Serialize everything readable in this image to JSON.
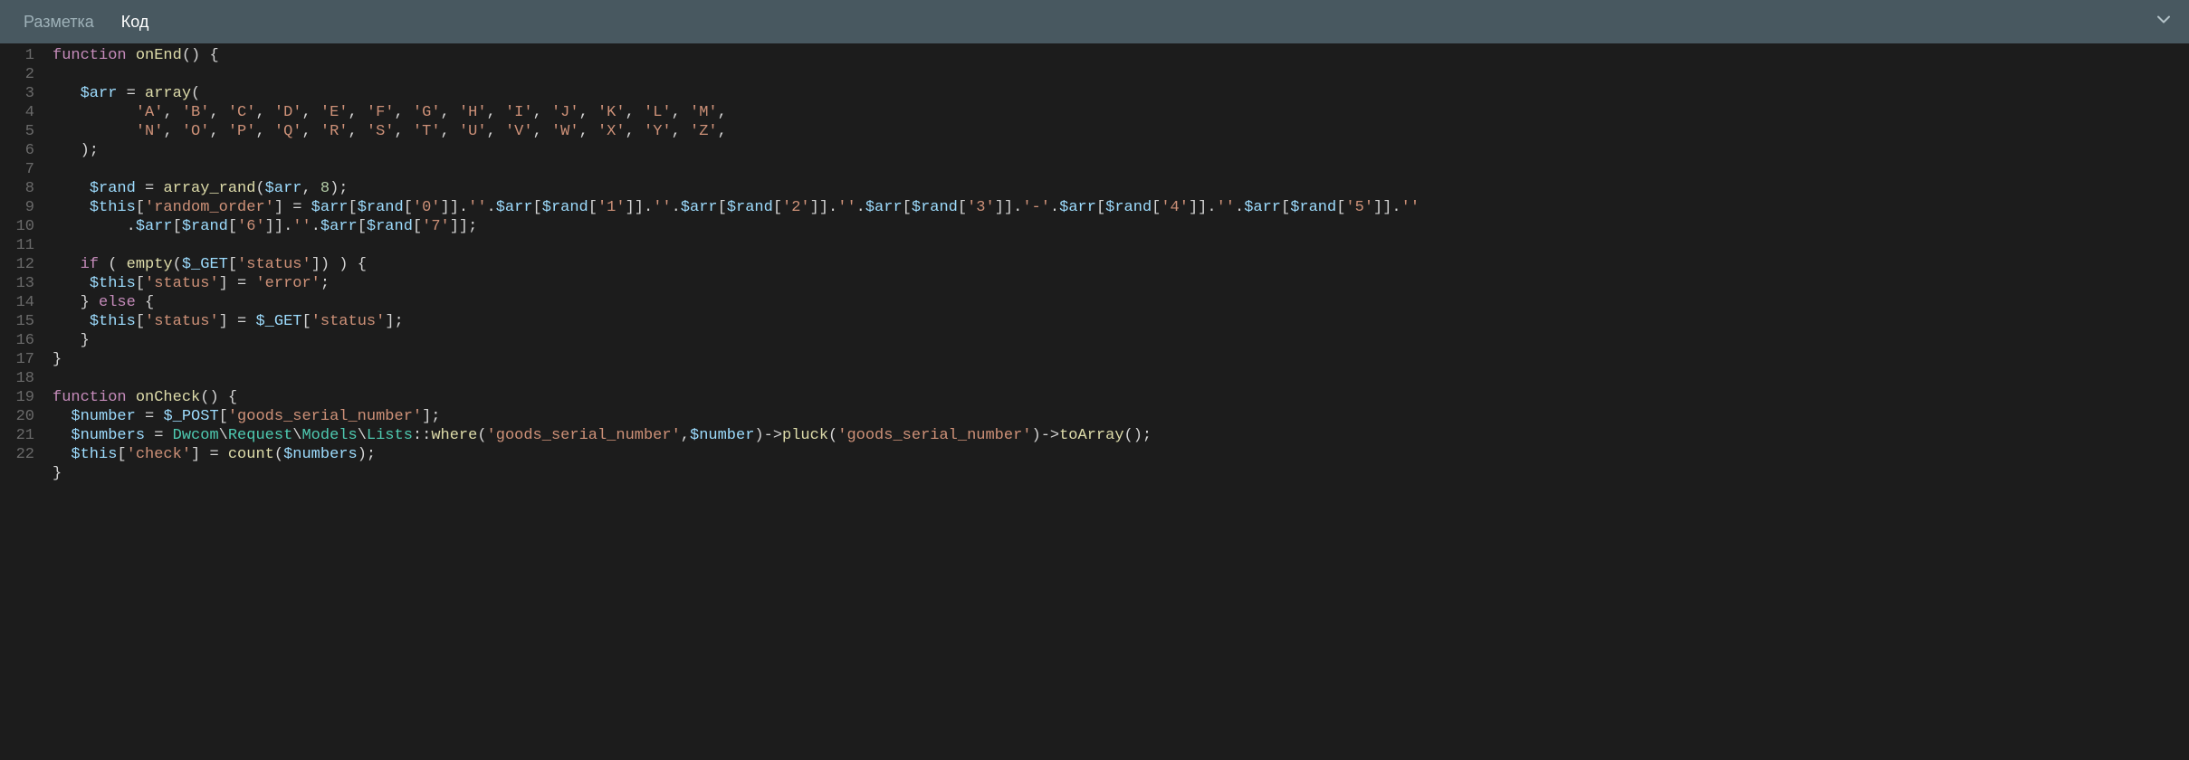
{
  "tabs": {
    "markup": "Разметка",
    "code": "Код",
    "active": "code"
  },
  "gutter": [
    "1",
    "2",
    "3",
    "4",
    "5",
    "6",
    "7",
    "8",
    "9",
    "10",
    "11",
    "12",
    "13",
    "14",
    "15",
    "16",
    "17",
    "18",
    "19",
    "20",
    "21",
    "22"
  ],
  "code_lines": [
    [
      {
        "t": "kw",
        "v": "function"
      },
      {
        "t": "punc",
        "v": " "
      },
      {
        "t": "fn",
        "v": "onEnd"
      },
      {
        "t": "punc",
        "v": "() {"
      }
    ],
    [],
    [
      {
        "t": "punc",
        "v": "   "
      },
      {
        "t": "var",
        "v": "$arr"
      },
      {
        "t": "punc",
        "v": " = "
      },
      {
        "t": "fn",
        "v": "array"
      },
      {
        "t": "punc",
        "v": "("
      }
    ],
    [
      {
        "t": "punc",
        "v": "         "
      },
      {
        "t": "str",
        "v": "'A'"
      },
      {
        "t": "punc",
        "v": ", "
      },
      {
        "t": "str",
        "v": "'B'"
      },
      {
        "t": "punc",
        "v": ", "
      },
      {
        "t": "str",
        "v": "'C'"
      },
      {
        "t": "punc",
        "v": ", "
      },
      {
        "t": "str",
        "v": "'D'"
      },
      {
        "t": "punc",
        "v": ", "
      },
      {
        "t": "str",
        "v": "'E'"
      },
      {
        "t": "punc",
        "v": ", "
      },
      {
        "t": "str",
        "v": "'F'"
      },
      {
        "t": "punc",
        "v": ", "
      },
      {
        "t": "str",
        "v": "'G'"
      },
      {
        "t": "punc",
        "v": ", "
      },
      {
        "t": "str",
        "v": "'H'"
      },
      {
        "t": "punc",
        "v": ", "
      },
      {
        "t": "str",
        "v": "'I'"
      },
      {
        "t": "punc",
        "v": ", "
      },
      {
        "t": "str",
        "v": "'J'"
      },
      {
        "t": "punc",
        "v": ", "
      },
      {
        "t": "str",
        "v": "'K'"
      },
      {
        "t": "punc",
        "v": ", "
      },
      {
        "t": "str",
        "v": "'L'"
      },
      {
        "t": "punc",
        "v": ", "
      },
      {
        "t": "str",
        "v": "'M'"
      },
      {
        "t": "punc",
        "v": ","
      }
    ],
    [
      {
        "t": "punc",
        "v": "         "
      },
      {
        "t": "str",
        "v": "'N'"
      },
      {
        "t": "punc",
        "v": ", "
      },
      {
        "t": "str",
        "v": "'O'"
      },
      {
        "t": "punc",
        "v": ", "
      },
      {
        "t": "str",
        "v": "'P'"
      },
      {
        "t": "punc",
        "v": ", "
      },
      {
        "t": "str",
        "v": "'Q'"
      },
      {
        "t": "punc",
        "v": ", "
      },
      {
        "t": "str",
        "v": "'R'"
      },
      {
        "t": "punc",
        "v": ", "
      },
      {
        "t": "str",
        "v": "'S'"
      },
      {
        "t": "punc",
        "v": ", "
      },
      {
        "t": "str",
        "v": "'T'"
      },
      {
        "t": "punc",
        "v": ", "
      },
      {
        "t": "str",
        "v": "'U'"
      },
      {
        "t": "punc",
        "v": ", "
      },
      {
        "t": "str",
        "v": "'V'"
      },
      {
        "t": "punc",
        "v": ", "
      },
      {
        "t": "str",
        "v": "'W'"
      },
      {
        "t": "punc",
        "v": ", "
      },
      {
        "t": "str",
        "v": "'X'"
      },
      {
        "t": "punc",
        "v": ", "
      },
      {
        "t": "str",
        "v": "'Y'"
      },
      {
        "t": "punc",
        "v": ", "
      },
      {
        "t": "str",
        "v": "'Z'"
      },
      {
        "t": "punc",
        "v": ","
      }
    ],
    [
      {
        "t": "punc",
        "v": "   );"
      }
    ],
    [],
    [
      {
        "t": "punc",
        "v": "    "
      },
      {
        "t": "var",
        "v": "$rand"
      },
      {
        "t": "punc",
        "v": " = "
      },
      {
        "t": "fn",
        "v": "array_rand"
      },
      {
        "t": "punc",
        "v": "("
      },
      {
        "t": "var",
        "v": "$arr"
      },
      {
        "t": "punc",
        "v": ", "
      },
      {
        "t": "num",
        "v": "8"
      },
      {
        "t": "punc",
        "v": ");"
      }
    ],
    [
      {
        "t": "punc",
        "v": "    "
      },
      {
        "t": "var",
        "v": "$this"
      },
      {
        "t": "punc",
        "v": "["
      },
      {
        "t": "str",
        "v": "'random_order'"
      },
      {
        "t": "punc",
        "v": "] = "
      },
      {
        "t": "var",
        "v": "$arr"
      },
      {
        "t": "punc",
        "v": "["
      },
      {
        "t": "var",
        "v": "$rand"
      },
      {
        "t": "punc",
        "v": "["
      },
      {
        "t": "str",
        "v": "'0'"
      },
      {
        "t": "punc",
        "v": "]]."
      },
      {
        "t": "str",
        "v": "''"
      },
      {
        "t": "punc",
        "v": "."
      },
      {
        "t": "var",
        "v": "$arr"
      },
      {
        "t": "punc",
        "v": "["
      },
      {
        "t": "var",
        "v": "$rand"
      },
      {
        "t": "punc",
        "v": "["
      },
      {
        "t": "str",
        "v": "'1'"
      },
      {
        "t": "punc",
        "v": "]]."
      },
      {
        "t": "str",
        "v": "''"
      },
      {
        "t": "punc",
        "v": "."
      },
      {
        "t": "var",
        "v": "$arr"
      },
      {
        "t": "punc",
        "v": "["
      },
      {
        "t": "var",
        "v": "$rand"
      },
      {
        "t": "punc",
        "v": "["
      },
      {
        "t": "str",
        "v": "'2'"
      },
      {
        "t": "punc",
        "v": "]]."
      },
      {
        "t": "str",
        "v": "''"
      },
      {
        "t": "punc",
        "v": "."
      },
      {
        "t": "var",
        "v": "$arr"
      },
      {
        "t": "punc",
        "v": "["
      },
      {
        "t": "var",
        "v": "$rand"
      },
      {
        "t": "punc",
        "v": "["
      },
      {
        "t": "str",
        "v": "'3'"
      },
      {
        "t": "punc",
        "v": "]]."
      },
      {
        "t": "str",
        "v": "'-'"
      },
      {
        "t": "punc",
        "v": "."
      },
      {
        "t": "var",
        "v": "$arr"
      },
      {
        "t": "punc",
        "v": "["
      },
      {
        "t": "var",
        "v": "$rand"
      },
      {
        "t": "punc",
        "v": "["
      },
      {
        "t": "str",
        "v": "'4'"
      },
      {
        "t": "punc",
        "v": "]]."
      },
      {
        "t": "str",
        "v": "''"
      },
      {
        "t": "punc",
        "v": "."
      },
      {
        "t": "var",
        "v": "$arr"
      },
      {
        "t": "punc",
        "v": "["
      },
      {
        "t": "var",
        "v": "$rand"
      },
      {
        "t": "punc",
        "v": "["
      },
      {
        "t": "str",
        "v": "'5'"
      },
      {
        "t": "punc",
        "v": "]]."
      },
      {
        "t": "str",
        "v": "''"
      }
    ],
    [
      {
        "t": "punc",
        "v": "        ."
      },
      {
        "t": "var",
        "v": "$arr"
      },
      {
        "t": "punc",
        "v": "["
      },
      {
        "t": "var",
        "v": "$rand"
      },
      {
        "t": "punc",
        "v": "["
      },
      {
        "t": "str",
        "v": "'6'"
      },
      {
        "t": "punc",
        "v": "]]."
      },
      {
        "t": "str",
        "v": "''"
      },
      {
        "t": "punc",
        "v": "."
      },
      {
        "t": "var",
        "v": "$arr"
      },
      {
        "t": "punc",
        "v": "["
      },
      {
        "t": "var",
        "v": "$rand"
      },
      {
        "t": "punc",
        "v": "["
      },
      {
        "t": "str",
        "v": "'7'"
      },
      {
        "t": "punc",
        "v": "]];"
      }
    ],
    [],
    [
      {
        "t": "punc",
        "v": "   "
      },
      {
        "t": "kw",
        "v": "if"
      },
      {
        "t": "punc",
        "v": " ( "
      },
      {
        "t": "fn",
        "v": "empty"
      },
      {
        "t": "punc",
        "v": "("
      },
      {
        "t": "var",
        "v": "$_GET"
      },
      {
        "t": "punc",
        "v": "["
      },
      {
        "t": "str",
        "v": "'status'"
      },
      {
        "t": "punc",
        "v": "]) ) {"
      }
    ],
    [
      {
        "t": "punc",
        "v": "    "
      },
      {
        "t": "var",
        "v": "$this"
      },
      {
        "t": "punc",
        "v": "["
      },
      {
        "t": "str",
        "v": "'status'"
      },
      {
        "t": "punc",
        "v": "] = "
      },
      {
        "t": "str",
        "v": "'error'"
      },
      {
        "t": "punc",
        "v": ";"
      }
    ],
    [
      {
        "t": "punc",
        "v": "   } "
      },
      {
        "t": "kw",
        "v": "else"
      },
      {
        "t": "punc",
        "v": " {"
      }
    ],
    [
      {
        "t": "punc",
        "v": "    "
      },
      {
        "t": "var",
        "v": "$this"
      },
      {
        "t": "punc",
        "v": "["
      },
      {
        "t": "str",
        "v": "'status'"
      },
      {
        "t": "punc",
        "v": "] = "
      },
      {
        "t": "var",
        "v": "$_GET"
      },
      {
        "t": "punc",
        "v": "["
      },
      {
        "t": "str",
        "v": "'status'"
      },
      {
        "t": "punc",
        "v": "];"
      }
    ],
    [
      {
        "t": "punc",
        "v": "   }"
      }
    ],
    [
      {
        "t": "punc",
        "v": "}"
      }
    ],
    [],
    [
      {
        "t": "kw",
        "v": "function"
      },
      {
        "t": "punc",
        "v": " "
      },
      {
        "t": "fn",
        "v": "onCheck"
      },
      {
        "t": "punc",
        "v": "() {"
      }
    ],
    [
      {
        "t": "punc",
        "v": "  "
      },
      {
        "t": "var",
        "v": "$number"
      },
      {
        "t": "punc",
        "v": " = "
      },
      {
        "t": "var",
        "v": "$_POST"
      },
      {
        "t": "punc",
        "v": "["
      },
      {
        "t": "str",
        "v": "'goods_serial_number'"
      },
      {
        "t": "punc",
        "v": "];"
      }
    ],
    [
      {
        "t": "punc",
        "v": "  "
      },
      {
        "t": "var",
        "v": "$numbers"
      },
      {
        "t": "punc",
        "v": " = "
      },
      {
        "t": "type",
        "v": "Dwcom"
      },
      {
        "t": "punc",
        "v": "\\"
      },
      {
        "t": "type",
        "v": "Request"
      },
      {
        "t": "punc",
        "v": "\\"
      },
      {
        "t": "type",
        "v": "Models"
      },
      {
        "t": "punc",
        "v": "\\"
      },
      {
        "t": "type",
        "v": "Lists"
      },
      {
        "t": "punc",
        "v": "::"
      },
      {
        "t": "fn",
        "v": "where"
      },
      {
        "t": "punc",
        "v": "("
      },
      {
        "t": "str",
        "v": "'goods_serial_number'"
      },
      {
        "t": "punc",
        "v": ","
      },
      {
        "t": "var",
        "v": "$number"
      },
      {
        "t": "punc",
        "v": ")->"
      },
      {
        "t": "fn",
        "v": "pluck"
      },
      {
        "t": "punc",
        "v": "("
      },
      {
        "t": "str",
        "v": "'goods_serial_number'"
      },
      {
        "t": "punc",
        "v": ")->"
      },
      {
        "t": "fn",
        "v": "toArray"
      },
      {
        "t": "punc",
        "v": "();"
      }
    ],
    [
      {
        "t": "punc",
        "v": "  "
      },
      {
        "t": "var",
        "v": "$this"
      },
      {
        "t": "punc",
        "v": "["
      },
      {
        "t": "str",
        "v": "'check'"
      },
      {
        "t": "punc",
        "v": "] = "
      },
      {
        "t": "fn",
        "v": "count"
      },
      {
        "t": "punc",
        "v": "("
      },
      {
        "t": "var",
        "v": "$numbers"
      },
      {
        "t": "punc",
        "v": ");"
      }
    ],
    [
      {
        "t": "punc",
        "v": "}"
      }
    ]
  ]
}
